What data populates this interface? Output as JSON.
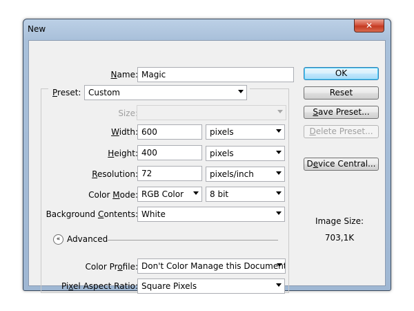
{
  "window": {
    "title": "New",
    "close_glyph": "✕"
  },
  "form": {
    "name": {
      "label": "Name:",
      "accel": "N",
      "rest": "ame:",
      "value": "Magic"
    },
    "preset": {
      "accel": "P",
      "rest": "reset:",
      "value": "Custom"
    },
    "size": {
      "label": "Size:",
      "value": ""
    },
    "width": {
      "accel": "W",
      "rest": "idth:",
      "value": "600",
      "unit": "pixels"
    },
    "height": {
      "accel": "H",
      "rest": "eight:",
      "value": "400",
      "unit": "pixels"
    },
    "resolution": {
      "accel": "R",
      "rest": "esolution:",
      "value": "72",
      "unit": "pixels/inch"
    },
    "color_mode": {
      "pre": "Color ",
      "accel": "M",
      "rest": "ode:",
      "value": "RGB Color",
      "depth": "8 bit"
    },
    "background": {
      "pre": "Background ",
      "accel": "C",
      "rest": "ontents:",
      "value": "White"
    },
    "advanced": {
      "label": "Advanced",
      "icon_glyph": "«"
    },
    "color_profile": {
      "pre": "Color Pr",
      "accel": "o",
      "rest": "file:",
      "value": "Don't Color Manage this Document"
    },
    "pixel_aspect": {
      "pre": "Pi",
      "accel": "x",
      "rest": "el Aspect Ratio:",
      "value": "Square Pixels"
    }
  },
  "buttons": {
    "ok": "OK",
    "reset": "Reset",
    "save_preset": {
      "accel": "S",
      "rest": "ave Preset..."
    },
    "delete_preset": {
      "accel": "D",
      "rest": "elete Preset..."
    },
    "device_central": {
      "pre": "D",
      "accel": "e",
      "rest": "vice Central..."
    }
  },
  "image_size": {
    "label": "Image Size:",
    "value": "703,1K"
  },
  "icons": {
    "close": "close-icon",
    "dropdown": "chevron-down-icon",
    "advanced": "collapse-icon"
  }
}
